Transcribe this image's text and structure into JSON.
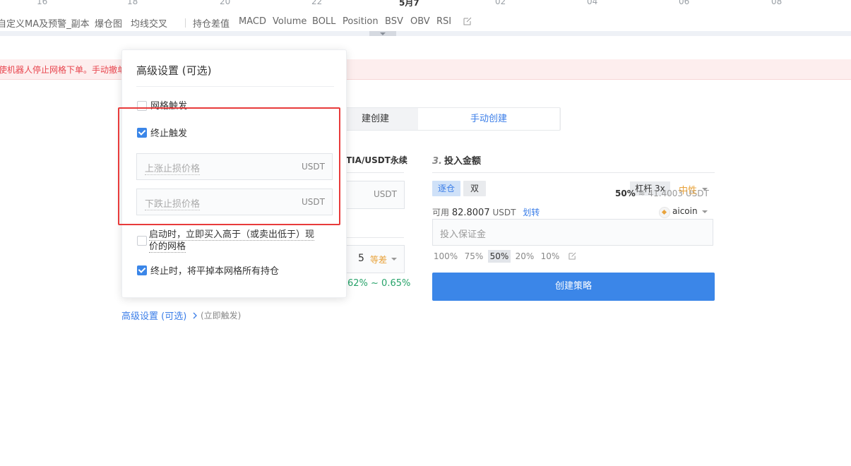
{
  "timeline": {
    "labels": [
      "16",
      "18",
      "20",
      "22",
      "5月7",
      "02",
      "04",
      "06",
      "08"
    ]
  },
  "indicators": {
    "left_group": [
      "自定义MA及预警_副本",
      "爆仓图",
      "均线交叉"
    ],
    "right_group": [
      "持仓差值",
      "MACD",
      "Volume",
      "BOLL",
      "Position",
      "BSV",
      "OBV",
      "RSI"
    ]
  },
  "alert": {
    "text": "使机器人停止网格下单。手动撤单"
  },
  "tabs": {
    "inactive_label": "建创建",
    "active_label": "手动创建"
  },
  "left_panel": {
    "pair_label": "TIA/USDT永续",
    "price_unit": "USDT",
    "grid_count": "5",
    "grid_mode": "等差",
    "profit_range": "62% ~ 0.65%"
  },
  "invest": {
    "section_number": "3.",
    "section_title": "投入金额",
    "margin_mode_isolated": "逐仓",
    "margin_mode_double": "双",
    "leverage_label": "杠杆 3x",
    "leverage_overlay": "≈ 41.4003 USDT",
    "leverage_overlay_pct": "50%",
    "direction": "中性",
    "available_label": "可用",
    "available_value": "82.8007",
    "available_unit": "USDT",
    "transfer_link": "划转",
    "account": "aicoin",
    "margin_placeholder": "投入保证金",
    "percentages": [
      "100%",
      "75%",
      "50%",
      "20%",
      "10%"
    ],
    "active_percentage": "50%",
    "create_button": "创建策略"
  },
  "advanced_link": {
    "label": "高级设置 (可选)",
    "sub": "(立即触发)"
  },
  "popup": {
    "title": "高级设置 (可选)",
    "grid_trigger_label": "网格触发",
    "grid_trigger_checked": false,
    "stop_trigger_label": "终止触发",
    "stop_trigger_checked": true,
    "upper_stop_placeholder": "上涨止损价格",
    "lower_stop_placeholder": "下跌止损价格",
    "unit": "USDT",
    "start_buy_label_line1": "启动时，立即买入高于（或卖出低于）现",
    "start_buy_label_line2": "价的网格",
    "start_buy_checked": false,
    "close_all_label": "终止时，将平掉本网格所有持仓",
    "close_all_checked": true
  },
  "colors": {
    "accent": "#3b86e8",
    "highlight_box": "#e83b3b",
    "alert_text": "#e8454e",
    "profit": "#27a36a",
    "warning": "#e8a33c"
  }
}
